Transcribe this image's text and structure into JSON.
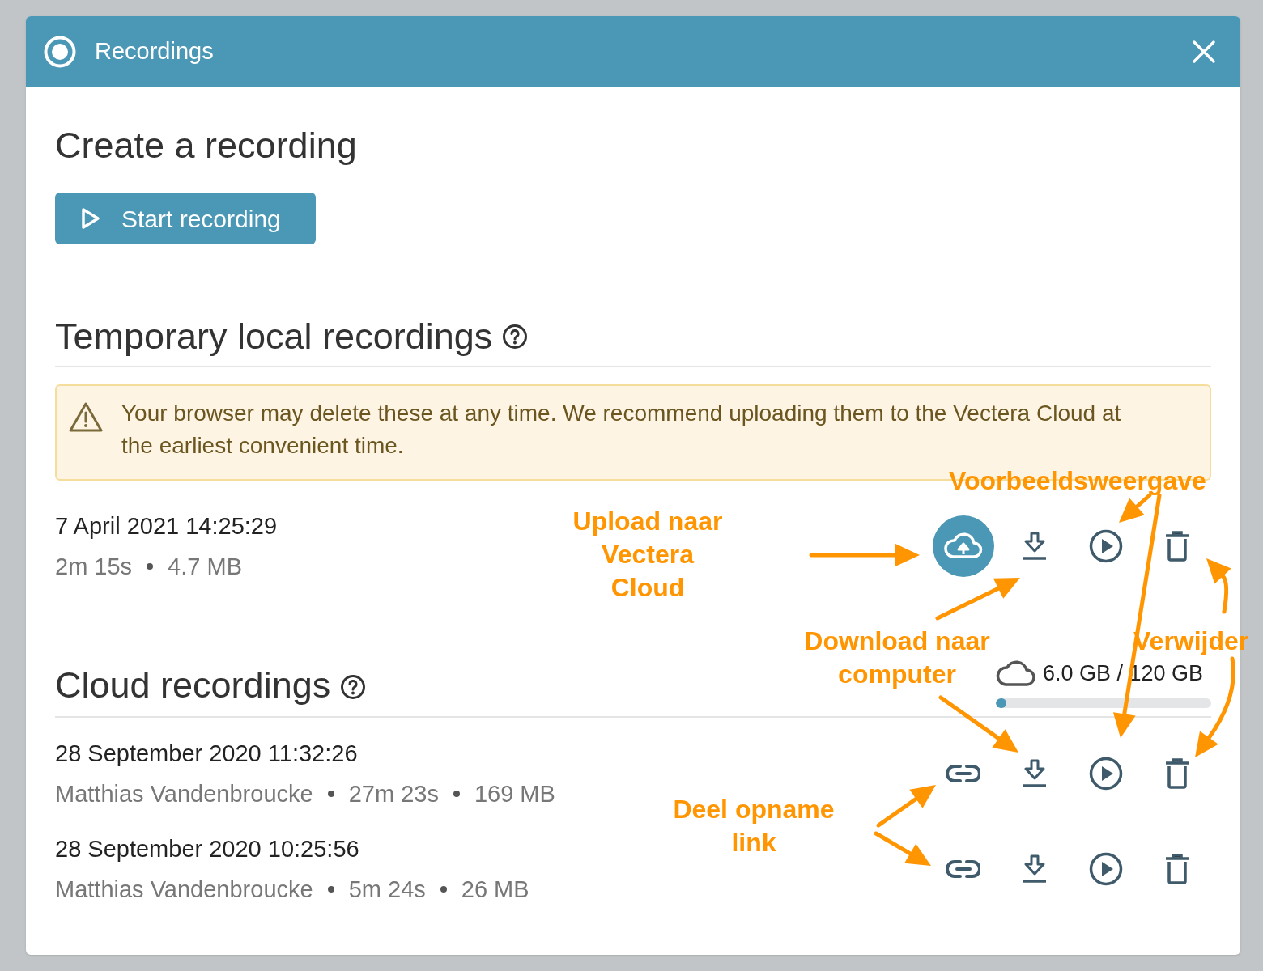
{
  "window": {
    "title": "Recordings"
  },
  "create": {
    "heading": "Create a recording",
    "button": "Start recording"
  },
  "local": {
    "heading": "Temporary local recordings",
    "warning": "Your browser may delete these at any time. We recommend uploading them to the Vectera Cloud at the earliest convenient time.",
    "recordings": [
      {
        "date": "7 April 2021 14:25:29",
        "details": [
          "2m 15s",
          "4.7 MB"
        ],
        "actions": [
          {
            "kind": "upload"
          },
          {
            "kind": "download"
          },
          {
            "kind": "play"
          },
          {
            "kind": "delete"
          }
        ]
      }
    ]
  },
  "cloud": {
    "heading": "Cloud recordings",
    "storage": {
      "reading": "6.0 GB / 120 GB",
      "level": 0.05
    },
    "recordings": [
      {
        "date": "28 September 2020 11:32:26",
        "details": [
          "Matthias Vandenbroucke",
          "27m 23s",
          "169 MB"
        ],
        "actions": [
          {
            "kind": "link"
          },
          {
            "kind": "download"
          },
          {
            "kind": "play"
          },
          {
            "kind": "delete"
          }
        ]
      },
      {
        "date": "28 September 2020 10:25:56",
        "details": [
          "Matthias Vandenbroucke",
          "5m 24s",
          "26 MB"
        ],
        "actions": [
          {
            "kind": "link"
          },
          {
            "kind": "download"
          },
          {
            "kind": "play"
          },
          {
            "kind": "delete"
          }
        ]
      }
    ]
  },
  "annotations": [
    {
      "text": "Voorbeeldsweergave"
    },
    {
      "text": "Upload naar\nVectera\nCloud"
    },
    {
      "text": "Download naar\ncomputer"
    },
    {
      "text": "Verwijder"
    },
    {
      "text": "Deel opname\nlink"
    }
  ]
}
